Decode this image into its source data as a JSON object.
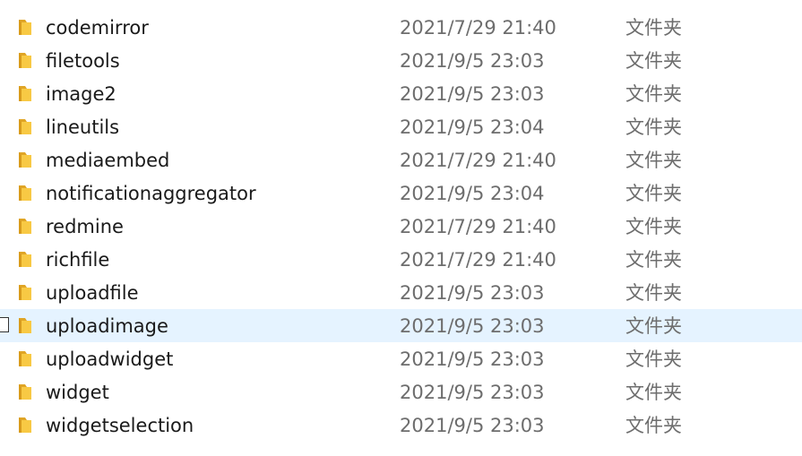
{
  "files": [
    {
      "name": "codemirror",
      "date": "2021/7/29 21:40",
      "type": "文件夹",
      "selected": false
    },
    {
      "name": "filetools",
      "date": "2021/9/5 23:03",
      "type": "文件夹",
      "selected": false
    },
    {
      "name": "image2",
      "date": "2021/9/5 23:03",
      "type": "文件夹",
      "selected": false
    },
    {
      "name": "lineutils",
      "date": "2021/9/5 23:04",
      "type": "文件夹",
      "selected": false
    },
    {
      "name": "mediaembed",
      "date": "2021/7/29 21:40",
      "type": "文件夹",
      "selected": false
    },
    {
      "name": "notificationaggregator",
      "date": "2021/9/5 23:04",
      "type": "文件夹",
      "selected": false
    },
    {
      "name": "redmine",
      "date": "2021/7/29 21:40",
      "type": "文件夹",
      "selected": false
    },
    {
      "name": "richfile",
      "date": "2021/7/29 21:40",
      "type": "文件夹",
      "selected": false
    },
    {
      "name": "uploadfile",
      "date": "2021/9/5 23:03",
      "type": "文件夹",
      "selected": false
    },
    {
      "name": "uploadimage",
      "date": "2021/9/5 23:03",
      "type": "文件夹",
      "selected": true
    },
    {
      "name": "uploadwidget",
      "date": "2021/9/5 23:03",
      "type": "文件夹",
      "selected": false
    },
    {
      "name": "widget",
      "date": "2021/9/5 23:03",
      "type": "文件夹",
      "selected": false
    },
    {
      "name": "widgetselection",
      "date": "2021/9/5 23:03",
      "type": "文件夹",
      "selected": false
    }
  ],
  "icon": "folder-icon",
  "colors": {
    "selected_row_bg": "#e5f3ff",
    "folder_yellow": "#f8c944",
    "folder_dark": "#e0a526"
  }
}
